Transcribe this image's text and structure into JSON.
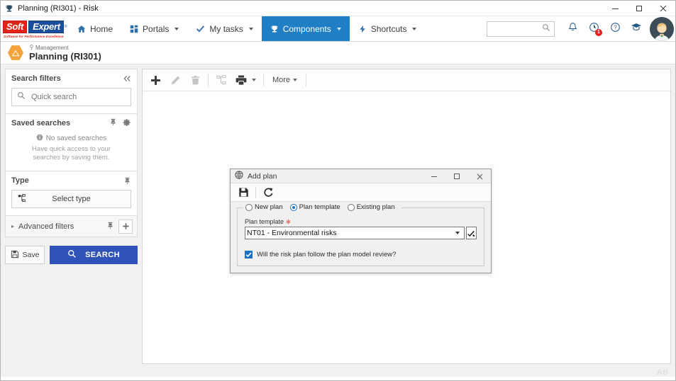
{
  "window": {
    "title": "Planning (RI301) - Risk",
    "icon": "trophy-icon",
    "minimize": "–",
    "maximize": "□",
    "close": "×"
  },
  "navbar": {
    "logo": {
      "part1": "Soft",
      "part2": "Expert",
      "reg": "®",
      "tagline": "Software for Performance Excellence"
    },
    "items": [
      {
        "id": "home",
        "label": "Home",
        "icon": "home-icon",
        "caret": false,
        "active": false
      },
      {
        "id": "portals",
        "label": "Portals",
        "icon": "grid-icon",
        "caret": true,
        "active": false
      },
      {
        "id": "my-tasks",
        "label": "My tasks",
        "icon": "check-icon",
        "caret": true,
        "active": false
      },
      {
        "id": "components",
        "label": "Components",
        "icon": "trophy-icon",
        "caret": true,
        "active": true
      },
      {
        "id": "shortcuts",
        "label": "Shortcuts",
        "icon": "bolt-icon",
        "caret": true,
        "active": false
      }
    ],
    "search": {
      "value": "",
      "placeholder": ""
    },
    "notifications": {
      "icon": "bell-icon",
      "count": ""
    },
    "alerts": {
      "icon": "clock-icon",
      "count": "1"
    },
    "help": {
      "icon": "question-icon"
    },
    "academy": {
      "icon": "graduation-cap-icon"
    },
    "avatar": {
      "icon": "user-avatar"
    }
  },
  "page": {
    "breadcrumb": "Management",
    "breadcrumb_icon": "pin-icon",
    "title": "Planning (RI301)",
    "header_icon": "warning-hex-icon"
  },
  "sidebar": {
    "header": {
      "title": "Search filters",
      "collapse_icon": "double-chevron-left-icon"
    },
    "quick_search": {
      "value": "",
      "placeholder": "Quick search",
      "icon": "search-icon"
    },
    "saved_searches": {
      "title": "Saved searches",
      "pin_icon": "pin-filter-icon",
      "gear_icon": "gear-icon",
      "empty_title": "No saved searches",
      "empty_icon": "info-icon",
      "empty_sub": "Have quick access to your searches by saving them."
    },
    "type": {
      "title": "Type",
      "pin_icon": "pin-filter-icon",
      "select_label": "Select type",
      "select_icon": "tree-icon"
    },
    "advanced": {
      "label": "Advanced filters",
      "arrow_icon": "chevron-right-icon",
      "pin_icon": "pin-filter-icon",
      "add_icon": "plus-icon"
    },
    "actions": {
      "save_label": "Save",
      "save_icon": "floppy-icon",
      "search_label": "SEARCH",
      "search_icon": "search-icon"
    }
  },
  "toolbar": {
    "buttons": [
      {
        "id": "add",
        "icon": "plus-icon",
        "disabled": false
      },
      {
        "id": "edit",
        "icon": "pencil-icon",
        "disabled": true
      },
      {
        "id": "delete",
        "icon": "trash-icon",
        "disabled": true
      },
      {
        "id": "hierarchy",
        "icon": "tree-icon",
        "disabled": true
      },
      {
        "id": "print",
        "icon": "printer-icon",
        "disabled": false
      }
    ],
    "more_label": "More"
  },
  "statusbar": {
    "watermark": "Ati"
  },
  "dialog": {
    "title": "Add plan",
    "title_icon": "globe-icon",
    "minimize": "–",
    "maximize": "□",
    "close": "×",
    "toolbar": {
      "save_icon": "floppy-icon",
      "refresh_icon": "refresh-icon"
    },
    "radios": [
      {
        "id": "new-plan",
        "label": "New plan",
        "selected": false
      },
      {
        "id": "plan-template",
        "label": "Plan template",
        "selected": true
      },
      {
        "id": "existing-plan",
        "label": "Existing plan",
        "selected": false
      }
    ],
    "plan_template": {
      "label": "Plan template",
      "required_marker": "✻",
      "value": "NT01 - Environmental risks",
      "options": [
        "NT01 - Environmental risks"
      ],
      "picker_icon": "pick-arrow-icon"
    },
    "checkbox": {
      "checked": true,
      "label": "Will the risk plan follow the plan model review?"
    }
  },
  "colors": {
    "brand_blue": "#1f7ec4",
    "brand_red": "#e2231a",
    "brand_navy": "#1b4f9c",
    "accent_orange": "#f2a33c",
    "search_button": "#2f53b8",
    "badge_red": "#e02020",
    "dialog_accent": "#1a72c4"
  }
}
